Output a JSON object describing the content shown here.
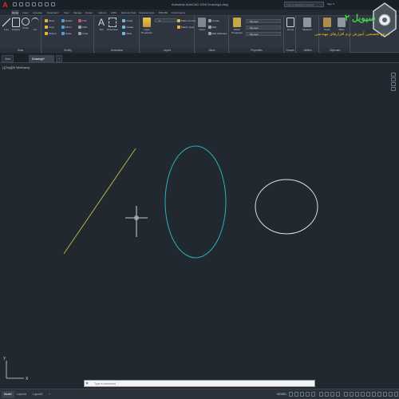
{
  "app": {
    "logo_letter": "A",
    "doc_title": "Autodesk AutoCAD 2016   Drawing1.dwg"
  },
  "search": {
    "placeholder": "Type a keyword or phrase"
  },
  "signin": "Sign In",
  "ribbon_tabs": [
    "Home",
    "Insert",
    "Annotate",
    "Parametric",
    "View",
    "Manage",
    "Output",
    "Add-ins",
    "A360",
    "Express Tools",
    "Featured Apps",
    "BIM 360",
    "Performance"
  ],
  "panels": {
    "draw": "Draw",
    "modify": "Modify",
    "annotation": "Annotation",
    "layers": "Layers",
    "block": "Block",
    "properties": "Properties",
    "groups": "Groups",
    "utilities": "Utilities",
    "clipboard": "Clipboard"
  },
  "draw_tools": [
    "Line",
    "Polyline",
    "Circle",
    "Arc"
  ],
  "modify_tools": [
    "Move",
    "Rotate",
    "Trim",
    "Copy",
    "Mirror",
    "Fillet",
    "Stretch",
    "Scale",
    "Array"
  ],
  "annotation_tools": [
    "Text",
    "Dimension",
    "Linear",
    "Leader",
    "Table"
  ],
  "layer_tools": [
    "Layer Properties",
    "Make Current",
    "Match Layer"
  ],
  "block_tools": [
    "Insert",
    "Create",
    "Edit",
    "Edit Attributes"
  ],
  "prop_tools": {
    "match": "Match Properties",
    "bylayer1": "ByLayer",
    "bylayer2": "ByLayer",
    "bylayer3": "ByLayer"
  },
  "group_tool": "Group",
  "util_tool": "Measure",
  "clip_tool": "Paste",
  "base_tool": "Base",
  "logo": {
    "text": "سيويل ٢",
    "sub": "مرجع تخصصی آموزش نرم افزارهای مهندسی"
  },
  "file_tabs": [
    "Start",
    "Drawing1*"
  ],
  "viewport_label": "[-][Top][2D Wireframe]",
  "cmd": {
    "close": "✕",
    "placeholder": "Type a command"
  },
  "layout_tabs": [
    "Model",
    "Layout1",
    "Layout2"
  ],
  "status": {
    "model": "MODEL"
  },
  "colors": {
    "line": "#b9b23c",
    "ellipse": "#2ab2b4",
    "circle": "#e4e4e4",
    "crosshair": "#ffffff",
    "logo_green": "#44d24a",
    "logo_yellow": "#f2c400"
  }
}
